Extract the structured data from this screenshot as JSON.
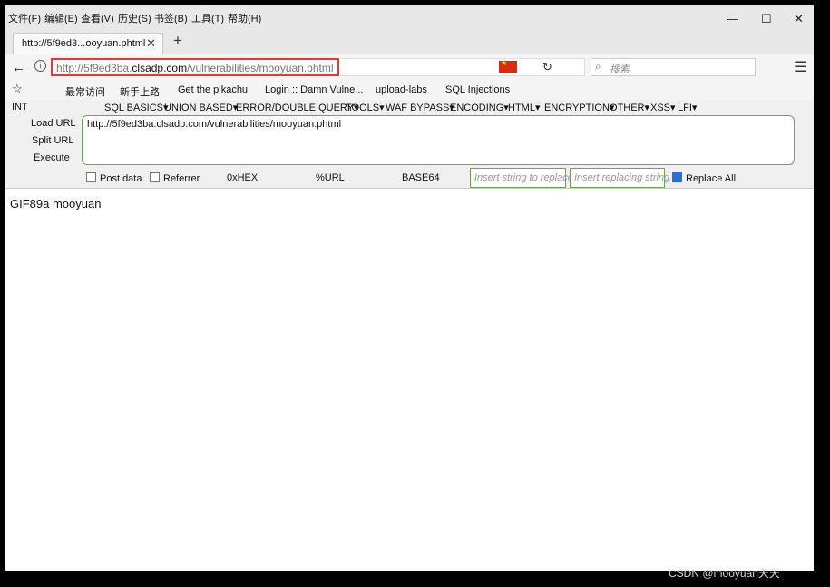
{
  "menubar": {
    "items": [
      "文件(F)",
      "编辑(E)",
      "查看(V)",
      "历史(S)",
      "书签(B)",
      "工具(T)",
      "帮助(H)"
    ],
    "window_controls": [
      "—",
      "☐",
      "✕"
    ]
  },
  "tab": {
    "title": "http://5f9ed3...ooyuan.phtml",
    "close": "✕",
    "new_tab": "+"
  },
  "nav": {
    "back": "←",
    "info": "i",
    "url_prefix": "http://5f9ed3ba.",
    "url_domain": "clsadp.com",
    "url_path": "/vulnerabilities/mooyuan.phtml",
    "search_placeholder": "搜索",
    "reload": "↻",
    "menu": "☰"
  },
  "bookmarks": {
    "items": [
      "最常访问",
      "新手上路",
      "Get the pikachu",
      "Login :: Damn Vulne...",
      "upload-labs",
      "SQL Injections"
    ]
  },
  "hackbar": {
    "select": "INT",
    "menus": [
      "SQL BASICS▾",
      "UNION BASED▾",
      "ERROR/DOUBLE QUERY▾",
      "TOOLS▾",
      "WAF BYPASS▾",
      "ENCODING▾",
      "HTML▾",
      "ENCRYPTION▾",
      "OTHER▾",
      "XSS▾",
      "LFI▾"
    ],
    "load_url": "Load URL",
    "split_url": "Split URL",
    "execute": "Execute",
    "url_value": "http://5f9ed3ba.clsadp.com/vulnerabilities/mooyuan.phtml",
    "post_data": "Post data",
    "referrer": "Referrer",
    "hex": "0xHEX",
    "urlenc": "%URL",
    "base64": "BASE64",
    "replace_placeholder": "Insert string to replace",
    "replacing_placeholder": "Insert replacing string",
    "replace_all": "Replace All"
  },
  "page": {
    "content": "GIF89a mooyuan"
  },
  "watermark": "CSDN @mooyuan天天",
  "colors": {
    "url_highlight": "#e03a3a",
    "hackbar_border": "#6aa84f"
  }
}
